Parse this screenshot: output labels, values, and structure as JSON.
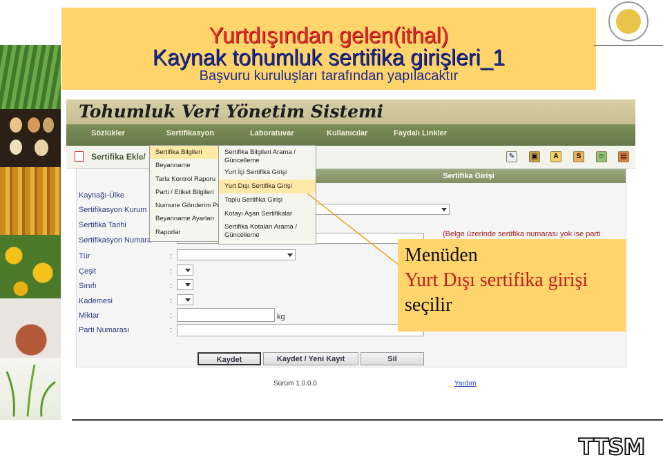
{
  "slide": {
    "title_line1": "Yurtdışından gelen(ithal)",
    "title_line2": "Kaynak tohumluk sertifika girişleri_1",
    "subtitle": "Başvuru kuruluşları tarafından yapılacaktır",
    "callout": {
      "line1": "Menüden",
      "line2": "Yurt Dışı sertifika girişi",
      "line3": "seçilir"
    },
    "footer_logo": "TTSM",
    "colors": {
      "title_red": "#e8252a",
      "title_blue": "#1a2a90",
      "box_yellow": "#ffd46b"
    }
  },
  "app": {
    "title": "Tohumluk Veri Yönetim Sistemi",
    "nav": [
      "Sözlükler",
      "Sertifikasyon",
      "Laboratuvar",
      "Kullanıcılar",
      "Faydalı Linkler"
    ],
    "breadcrumb": "Sertifika Ekle/",
    "toolbar_icons": [
      "doc-icon",
      "gift-icon",
      "a-icon",
      "s-icon",
      "person-icon",
      "trash-icon"
    ],
    "menu_primary": [
      "Sertifika Bilgileri",
      "Beyanname",
      "Tarla Kontrol Raporu",
      "Parti / Etiket Bilgileri",
      "Numune Gönderim Pr",
      "Beyanname Ayarları",
      "Raporlar"
    ],
    "menu_secondary": [
      "Sertifika Bilgileri Arama / Güncelleme",
      "Yurt İçi Sertifika Girişi",
      "Yurt Dışı Sertifika Girişi",
      "Toplu Sertifika Girişi",
      "Kotayı Aşan Sertifikalar",
      "Sertifika Kotaları Arama / Güncelleme"
    ],
    "form": {
      "header": "Sertifika Girişi",
      "labels": [
        "Kaynağı-Ülke",
        "Sertifikasyon Kurum",
        "Sertifika Tarihi",
        "Sertifikasyon Numara",
        "Tür",
        "Çeşit",
        "Sınıfı",
        "Kademesi",
        "Miktar",
        "Parti Numarası"
      ],
      "colon": ":",
      "unit": "kg",
      "note": "(Belge üzerinde sertifika numarası yok ise parti"
    },
    "buttons": {
      "save": "Kaydet",
      "save_new": "Kaydet / Yeni Kayıt",
      "delete": "Sil"
    },
    "version": "Sürüm 1.0.0.0",
    "help": "Yardım"
  }
}
